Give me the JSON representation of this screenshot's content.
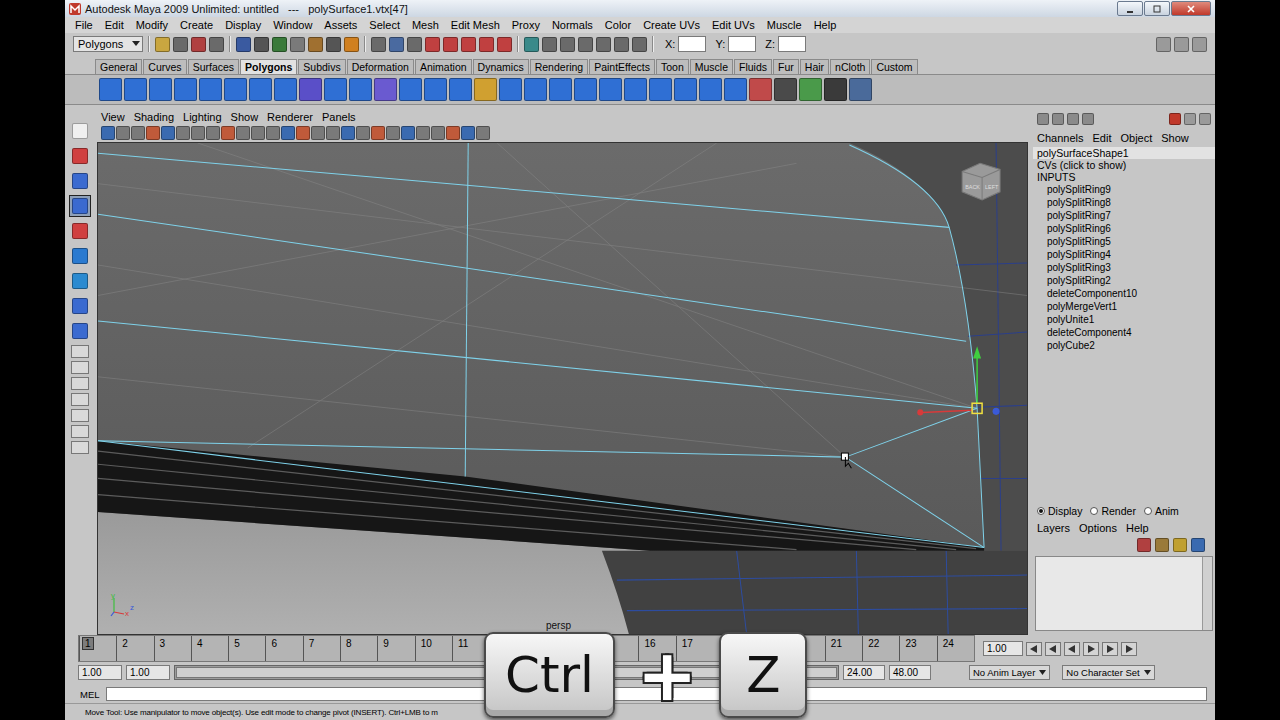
{
  "window": {
    "title": "Autodesk Maya 2009 Unlimited: untitled   ---   polySurface1.vtx[47]"
  },
  "menu_bar": [
    "File",
    "Edit",
    "Modify",
    "Create",
    "Display",
    "Window",
    "Assets",
    "Select",
    "Mesh",
    "Edit Mesh",
    "Proxy",
    "Normals",
    "Color",
    "Create UVs",
    "Edit UVs",
    "Muscle",
    "Help"
  ],
  "status_line": {
    "mode": "Polygons",
    "fields": [
      {
        "label": "X:",
        "value": ""
      },
      {
        "label": "Y:",
        "value": ""
      },
      {
        "label": "Z:",
        "value": ""
      }
    ]
  },
  "shelf_tabs": [
    {
      "label": "General",
      "selected": false
    },
    {
      "label": "Curves",
      "selected": false
    },
    {
      "label": "Surfaces",
      "selected": false
    },
    {
      "label": "Polygons",
      "selected": true
    },
    {
      "label": "Subdivs",
      "selected": false
    },
    {
      "label": "Deformation",
      "selected": false
    },
    {
      "label": "Animation",
      "selected": false
    },
    {
      "label": "Dynamics",
      "selected": false
    },
    {
      "label": "Rendering",
      "selected": false
    },
    {
      "label": "PaintEffects",
      "selected": false
    },
    {
      "label": "Toon",
      "selected": false
    },
    {
      "label": "Muscle",
      "selected": false
    },
    {
      "label": "Fluids",
      "selected": false
    },
    {
      "label": "Fur",
      "selected": false
    },
    {
      "label": "Hair",
      "selected": false
    },
    {
      "label": "nCloth",
      "selected": false
    },
    {
      "label": "Custom",
      "selected": false
    }
  ],
  "toolbox": {
    "tools": [
      {
        "selected": false
      },
      {
        "selected": false
      },
      {
        "selected": false
      },
      {
        "selected": true
      },
      {
        "selected": false
      },
      {
        "selected": false
      },
      {
        "selected": false
      },
      {
        "selected": false
      },
      {
        "selected": false
      }
    ]
  },
  "viewport": {
    "menus": [
      "View",
      "Shading",
      "Lighting",
      "Show",
      "Renderer",
      "Panels"
    ],
    "camera": "persp",
    "viewcube": [
      "BACK",
      "LEFT"
    ],
    "axes": [
      {
        "label": "y",
        "color": "#3fbf3f"
      },
      {
        "label": "x",
        "color": "#d83a3a"
      },
      {
        "label": "z",
        "color": "#3a5ad8"
      }
    ]
  },
  "channel_box": {
    "menus": [
      "Channels",
      "Edit",
      "Object",
      "Show"
    ],
    "object": "polySurfaceShape1",
    "cvs": "CVs (click to show)",
    "inputs_label": "INPUTS",
    "inputs": [
      "polySplitRing9",
      "polySplitRing8",
      "polySplitRing7",
      "polySplitRing6",
      "polySplitRing5",
      "polySplitRing4",
      "polySplitRing3",
      "polySplitRing2",
      "deleteComponent10",
      "polyMergeVert1",
      "polyUnite1",
      "deleteComponent4",
      "polyCube2"
    ]
  },
  "layer_editor": {
    "modes": [
      {
        "label": "Display",
        "selected": true
      },
      {
        "label": "Render",
        "selected": false
      },
      {
        "label": "Anim",
        "selected": false
      }
    ],
    "menus": [
      "Layers",
      "Options",
      "Help"
    ]
  },
  "timeline": {
    "frames": [
      {
        "label": "1",
        "selected": true
      },
      {
        "label": "2",
        "selected": false
      },
      {
        "label": "3",
        "selected": false
      },
      {
        "label": "4",
        "selected": false
      },
      {
        "label": "5",
        "selected": false
      },
      {
        "label": "6",
        "selected": false
      },
      {
        "label": "7",
        "selected": false
      },
      {
        "label": "8",
        "selected": false
      },
      {
        "label": "9",
        "selected": false
      },
      {
        "label": "10",
        "selected": false
      },
      {
        "label": "11",
        "selected": false
      },
      {
        "label": "16",
        "selected": false
      },
      {
        "label": "17",
        "selected": false
      },
      {
        "label": "21",
        "selected": false
      },
      {
        "label": "22",
        "selected": false
      },
      {
        "label": "23",
        "selected": false
      },
      {
        "label": "24",
        "selected": false
      }
    ],
    "current_frame": "1.00"
  },
  "range_slider": {
    "start": "1.00",
    "range_start": "1.00",
    "range_end": "24.00",
    "end": "48.00",
    "anim_layer": "No Anim Layer",
    "character_set": "No Character Set"
  },
  "command_line": {
    "language": "MEL"
  },
  "help_line": "Move Tool: Use manipulator to move object(s). Use edit mode to change pivot (INSERT). Ctrl+LMB to m",
  "keystroke": {
    "keys": [
      "Ctrl",
      "Z"
    ],
    "separator": "+"
  }
}
